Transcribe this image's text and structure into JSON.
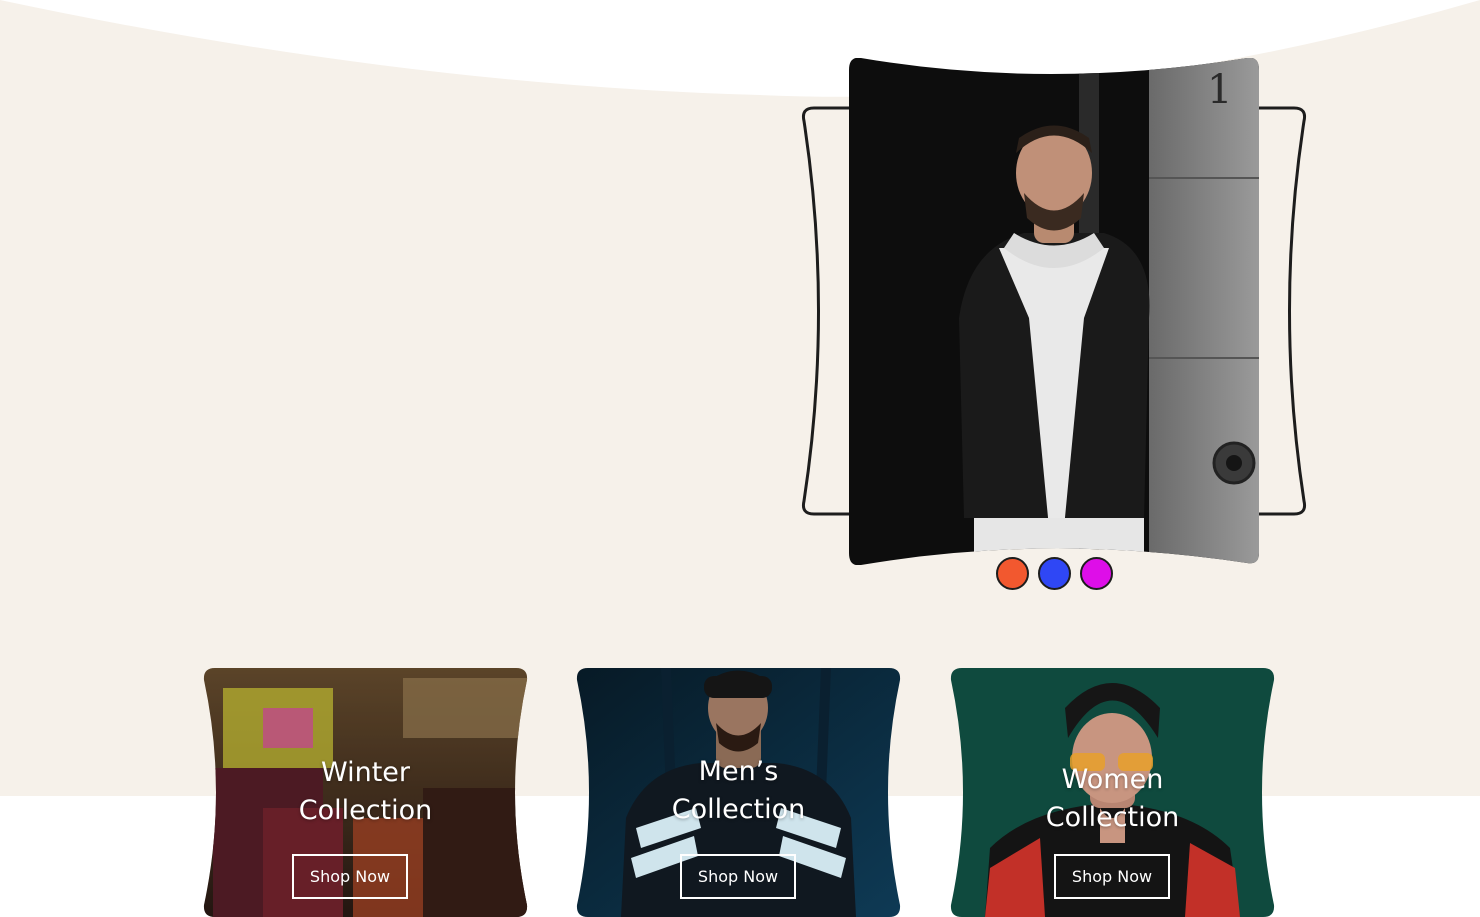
{
  "hero": {
    "background_color": "#f6f1ea",
    "slider": {
      "image": "man-in-black-corduroy-sherpa-jacket-photo",
      "corner_number": "1",
      "dots": [
        {
          "color": "#f2582f",
          "label": "orange"
        },
        {
          "color": "#2f47f5",
          "label": "blue"
        },
        {
          "color": "#de0ee8",
          "label": "magenta"
        }
      ]
    }
  },
  "collections": [
    {
      "title_line1": "Winter",
      "title_line2": "Collection",
      "button_label": "Shop Now",
      "image": "clothes-on-hangers-photo"
    },
    {
      "title_line1": "Men’s",
      "title_line2": "Collection",
      "button_label": "Shop Now",
      "image": "man-in-beanie-track-jacket-photo"
    },
    {
      "title_line1": "Women",
      "title_line2": "Collection",
      "button_label": "Shop Now",
      "image": "woman-in-beanie-sunglasses-photo"
    }
  ]
}
